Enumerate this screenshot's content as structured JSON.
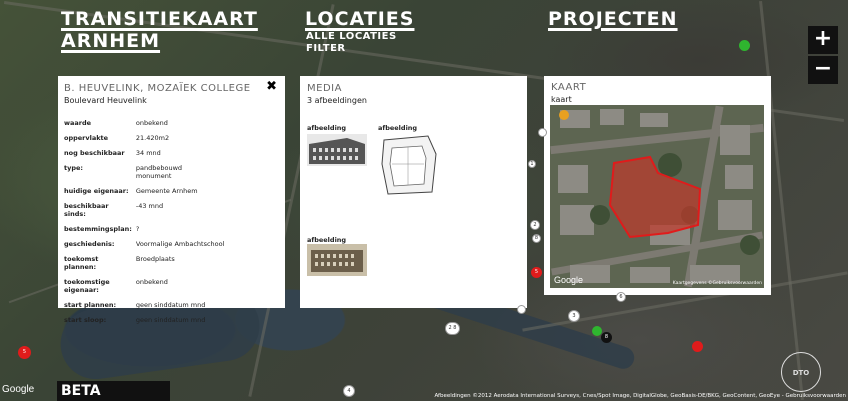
{
  "header": {
    "title_line1": "TRANSITIEKAART",
    "title_line2": "ARNHEM",
    "locaties": "LOCATIES",
    "locaties_links": [
      "ALLE LOCATIES",
      "FILTER"
    ],
    "projecten": "PROJECTEN"
  },
  "zoom": {
    "plus": "+",
    "minus": "−"
  },
  "info_panel": {
    "title": "B. HEUVELINK, MOZAÏEK COLLEGE",
    "subtitle": "Boulevard Heuvelink",
    "close": "✖",
    "rows": [
      {
        "k": "waarde",
        "v": "onbekend"
      },
      {
        "k": "oppervlakte",
        "v": "21.420m2"
      },
      {
        "k": "nog beschikbaar",
        "v": "34 mnd"
      },
      {
        "k": "type:",
        "v": "pandbebouwd\nmonument"
      },
      {
        "k": "huidige eigenaar:",
        "v": "Gemeente Arnhem"
      },
      {
        "k": "beschikbaar sinds:",
        "v": "-43 mnd"
      },
      {
        "k": "bestemmingsplan:",
        "v": "?"
      },
      {
        "k": "geschiedenis:",
        "v": "Voormalige Ambachtschool"
      },
      {
        "k": "toekomst plannen:",
        "v": "Broedplaats"
      },
      {
        "k": "toekomstige eigenaar:",
        "v": "onbekend"
      },
      {
        "k": "start plannen:",
        "v": "geen sinddatum mnd"
      },
      {
        "k": "start sloop:",
        "v": "geen sinddatum mnd"
      }
    ]
  },
  "media_panel": {
    "title": "MEDIA",
    "subtitle": "3 afbeeldingen",
    "items": [
      {
        "label": "afbeelding"
      },
      {
        "label": "afbeelding"
      },
      {
        "label": "afbeelding"
      }
    ]
  },
  "map_panel": {
    "title": "KAART",
    "subtitle": "kaart",
    "google": "Google",
    "attrib": "Kaartgegevens  ©Gebruiksvoorwaarden"
  },
  "beta": "BETA",
  "google_logo": "Google",
  "attribution": "Afbeeldingen ©2012 Aerodata International Surveys, Cnes/Spot Image, DigitalGlobe, GeoBasis-DE/BKG, GeoContent, GeoEye - Gebruiksvoorwaarden",
  "seal_text": "DTO",
  "markers": [
    {
      "t": "2"
    },
    {
      "t": "8"
    },
    {
      "t": "5"
    },
    {
      "t": "3"
    },
    {
      "t": "2 8"
    },
    {
      "t": "5"
    },
    {
      "t": "4"
    },
    {
      "t": "8"
    },
    {
      "t": "6"
    },
    {
      "t": "1"
    }
  ],
  "colors": {
    "accent_red": "#e01b1b",
    "marker_green": "#2fb52f",
    "panel_bg": "#ffffff",
    "header_text": "#ffffff"
  }
}
